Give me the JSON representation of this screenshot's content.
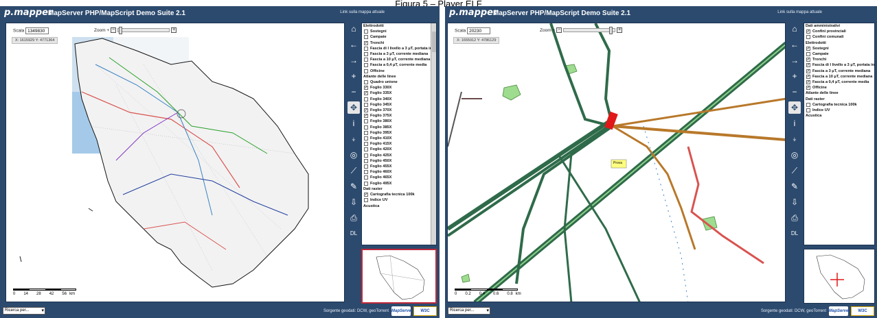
{
  "caption": "Figura 5 – Player ELF",
  "app": {
    "logo": "p.mapper",
    "title": "MapServer PHP/MapScript Demo Suite 2.1",
    "top_link": "Link sulla mappa attuale",
    "scale_label": "Scala",
    "zoom_label": "Zoom +",
    "bottom_select": "Ricerca per...",
    "source_text": "Sorgente geodati: DCW, geoTorrent",
    "badge_mapserver": "MapServer",
    "badge_xhtml": "W3C XHTML 1.0"
  },
  "tools": [
    {
      "name": "home-icon",
      "glyph": "⌂"
    },
    {
      "name": "back-icon",
      "glyph": "←"
    },
    {
      "name": "forward-icon",
      "glyph": "→"
    },
    {
      "name": "zoom-in-icon",
      "glyph": "+"
    },
    {
      "name": "zoom-out-icon",
      "glyph": "−"
    },
    {
      "name": "pan-icon",
      "glyph": "✥"
    },
    {
      "name": "info-icon",
      "glyph": "i"
    },
    {
      "name": "select-icon",
      "glyph": "⍖"
    },
    {
      "name": "auto-identify-icon",
      "glyph": "◎"
    },
    {
      "name": "measure-icon",
      "glyph": "⟋"
    },
    {
      "name": "poi-icon",
      "glyph": "✎"
    },
    {
      "name": "download-icon",
      "glyph": "⇩"
    },
    {
      "name": "print-icon",
      "glyph": "⎙"
    },
    {
      "name": "download-label",
      "glyph": "DL"
    }
  ],
  "left": {
    "scale_value": "1349830",
    "coords": "X: 1615929   Y: 4771364",
    "zoom_level": 0.02,
    "scalebar_labels": [
      "0",
      "14",
      "28",
      "42",
      "56",
      "km"
    ],
    "toc": [
      {
        "label": "Elettrodotti",
        "type": "group"
      },
      {
        "label": "Sostegni",
        "checked": false
      },
      {
        "label": "Campate",
        "checked": false
      },
      {
        "label": "Tronchi",
        "checked": true
      },
      {
        "label": "Fascia di I livello a 3 μT, portata in servizio normale",
        "checked": false
      },
      {
        "label": "Fascia a 3 μT, corrente mediana",
        "checked": false
      },
      {
        "label": "Fascia a 10 μT, corrente mediana",
        "checked": false
      },
      {
        "label": "Fascia a 0,4 μT, corrente media",
        "checked": false
      },
      {
        "label": "Officine",
        "checked": false
      },
      {
        "label": "Atlante delle linee",
        "type": "group"
      },
      {
        "label": "Quadro unione",
        "checked": false
      },
      {
        "label": "Foglio 330X",
        "checked": true
      },
      {
        "label": "Foglio 335X",
        "checked": true
      },
      {
        "label": "Foglio 340X",
        "checked": false
      },
      {
        "label": "Foglio 345X",
        "checked": false
      },
      {
        "label": "Foglio 370X",
        "checked": true
      },
      {
        "label": "Foglio 375X",
        "checked": true
      },
      {
        "label": "Foglio 380X",
        "checked": false
      },
      {
        "label": "Foglio 385X",
        "checked": false
      },
      {
        "label": "Foglio 395X",
        "checked": false
      },
      {
        "label": "Foglio 410X",
        "checked": false
      },
      {
        "label": "Foglio 415X",
        "checked": false
      },
      {
        "label": "Foglio 420X",
        "checked": false
      },
      {
        "label": "Foglio 425X",
        "checked": false
      },
      {
        "label": "Foglio 450X",
        "checked": false
      },
      {
        "label": "Foglio 455X",
        "checked": false
      },
      {
        "label": "Foglio 460X",
        "checked": false
      },
      {
        "label": "Foglio 465X",
        "checked": false
      },
      {
        "label": "Foglio 495X",
        "checked": false
      },
      {
        "label": "Dati raster",
        "type": "group"
      },
      {
        "label": "Cartografia tecnica 100k",
        "checked": true
      },
      {
        "label": "Indice UV",
        "checked": false
      },
      {
        "label": "Acustica",
        "type": "group"
      }
    ]
  },
  "right": {
    "scale_value": "20230",
    "coords": "X: 1655912   Y: 4786129",
    "zoom_level": 0.94,
    "scalebar_labels": [
      "0",
      "0.2",
      "0.4",
      "0.6",
      "0.8",
      "km"
    ],
    "popup_label": "Prova",
    "toc": [
      {
        "label": "Dati amministrativi",
        "type": "group"
      },
      {
        "label": "Confini provinciali",
        "checked": true
      },
      {
        "label": "Confini comunali",
        "checked": false
      },
      {
        "label": "Elettrodotti",
        "type": "group"
      },
      {
        "label": "Sostegni",
        "checked": true
      },
      {
        "label": "Campate",
        "checked": false
      },
      {
        "label": "Tronchi",
        "checked": true
      },
      {
        "label": "Fascia di I livello a 3 μT, portata in servizio normale",
        "checked": true
      },
      {
        "label": "Fascia a 3 μT, corrente mediana",
        "checked": true
      },
      {
        "label": "Fascia a 10 μT, corrente mediana",
        "checked": true
      },
      {
        "label": "Fascia a 0,4 μT, corrente media",
        "checked": true
      },
      {
        "label": "Officine",
        "checked": true
      },
      {
        "label": "Atlante delle linee",
        "type": "group"
      },
      {
        "label": "Dati raster",
        "type": "group"
      },
      {
        "label": "Cartografia tecnica 100k",
        "checked": false
      },
      {
        "label": "Indice UV",
        "checked": false
      },
      {
        "label": "Acustica",
        "type": "group"
      }
    ]
  },
  "colors": {
    "chrome": "#2c4a6e",
    "line_green": "#2f6b4a",
    "line_orange": "#b8782a",
    "line_red": "#d9534f",
    "line_blue": "#3b82c4",
    "area_green": "#9edc8f",
    "highlight": "#c0283a"
  }
}
